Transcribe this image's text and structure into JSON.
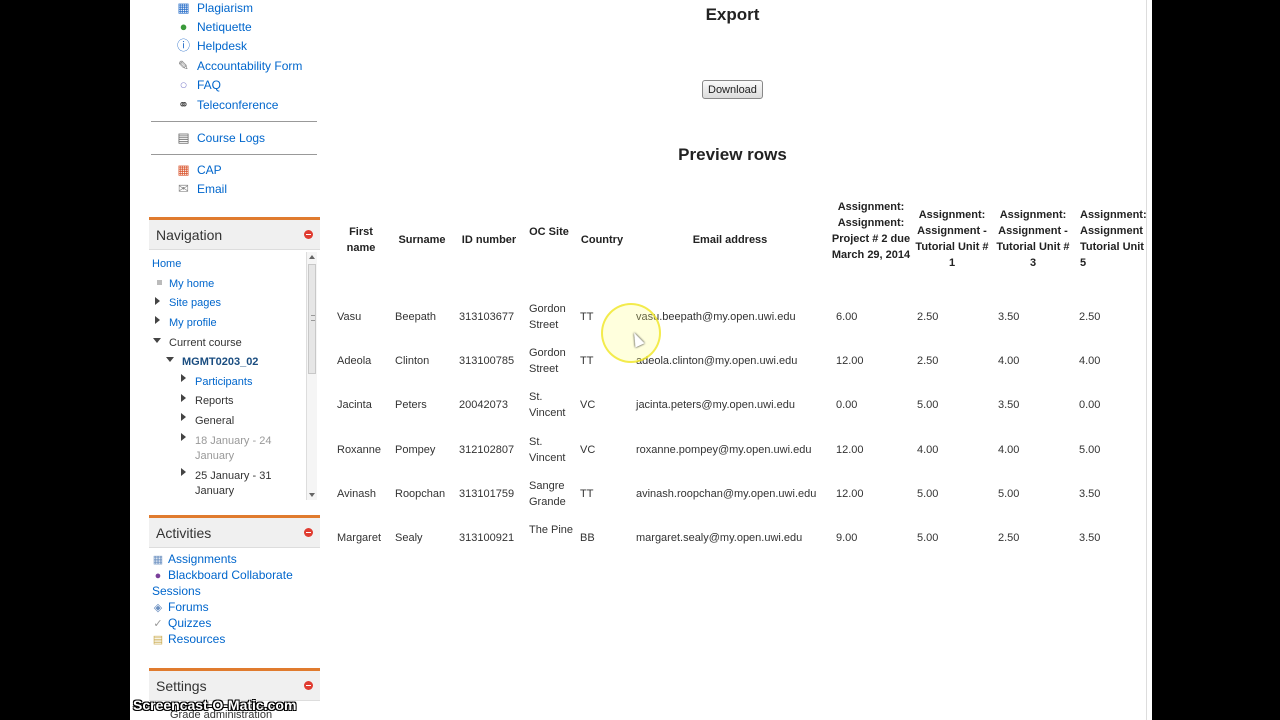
{
  "sidebar": {
    "top_links": [
      {
        "label": "Plagiarism",
        "icon": "book-icon"
      },
      {
        "label": "Netiquette",
        "icon": "people-icon"
      },
      {
        "label": "Helpdesk",
        "icon": "help-icon"
      },
      {
        "label": "Accountability Form",
        "icon": "form-icon"
      },
      {
        "label": "FAQ",
        "icon": "chat-icon"
      },
      {
        "label": "Teleconference",
        "icon": "headphones-icon"
      }
    ],
    "course_logs": "Course Logs",
    "cap": "CAP",
    "email": "Email"
  },
  "navigation": {
    "title": "Navigation",
    "home": "Home",
    "my_home": "My home",
    "site_pages": "Site pages",
    "my_profile": "My profile",
    "current_course": "Current course",
    "course_code": "MGMT0203_02",
    "participants": "Participants",
    "reports": "Reports",
    "general": "General",
    "week1": "18 January - 24 January",
    "week2": "25 January - 31 January"
  },
  "activities": {
    "title": "Activities",
    "items": [
      "Assignments",
      "Blackboard Collaborate",
      "Sessions",
      "Forums",
      "Quizzes",
      "Resources"
    ]
  },
  "settings": {
    "title": "Settings",
    "sub": "Grade administration"
  },
  "main": {
    "export_title": "Export",
    "download_label": "Download",
    "preview_title": "Preview rows"
  },
  "table": {
    "headers": [
      "First name",
      "Surname",
      "ID number",
      "OC Site",
      "Country",
      "Email address",
      "Assignment: Assignment: Project # 2 due March 29, 2014",
      "Assignment: Assignment - Tutorial Unit # 1",
      "Assignment: Assignment - Tutorial Unit # 3",
      "Assignment: Assignment - Tutorial Unit # 5"
    ],
    "rows": [
      [
        "Vasu",
        "Beepath",
        "313103677",
        "Gordon Street",
        "TT",
        "vasu.beepath@my.open.uwi.edu",
        "6.00",
        "2.50",
        "3.50",
        "2.50"
      ],
      [
        "Adeola",
        "Clinton",
        "313100785",
        "Gordon Street",
        "TT",
        "adeola.clinton@my.open.uwi.edu",
        "12.00",
        "2.50",
        "4.00",
        "4.00"
      ],
      [
        "Jacinta",
        "Peters",
        "20042073",
        "St. Vincent",
        "VC",
        "jacinta.peters@my.open.uwi.edu",
        "0.00",
        "5.00",
        "3.50",
        "0.00"
      ],
      [
        "Roxanne",
        "Pompey",
        "312102807",
        "St. Vincent",
        "VC",
        "roxanne.pompey@my.open.uwi.edu",
        "12.00",
        "4.00",
        "4.00",
        "5.00"
      ],
      [
        "Avinash",
        "Roopchan",
        "313101759",
        "Sangre Grande",
        "TT",
        "avinash.roopchan@my.open.uwi.edu",
        "12.00",
        "5.00",
        "5.00",
        "3.50"
      ],
      [
        "Margaret",
        "Sealy",
        "313100921",
        "The Pine",
        "BB",
        "margaret.sealy@my.open.uwi.edu",
        "9.00",
        "5.00",
        "2.50",
        "3.50"
      ]
    ]
  },
  "watermark": "Screencast-O-Matic.com",
  "colors": {
    "link": "#0066cc",
    "block_accent": "#e07b2e",
    "close": "#e03c31"
  }
}
